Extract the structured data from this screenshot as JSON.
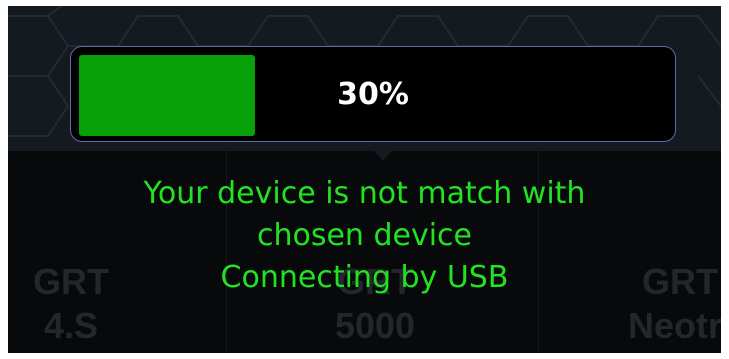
{
  "progress": {
    "percent": 30,
    "label": "30%",
    "fill_color": "#08a10a",
    "border_color": "#5f6ba8"
  },
  "message": {
    "line1": "Your device is not match with",
    "line2": "chosen device",
    "line3": "Connecting by USB",
    "color": "#22e222"
  },
  "devices": [
    {
      "line1": "GRT",
      "line2": "4.S"
    },
    {
      "line1": "GRT",
      "line2": "5000"
    },
    {
      "line1": "GRT",
      "line2": "Neotro"
    }
  ]
}
